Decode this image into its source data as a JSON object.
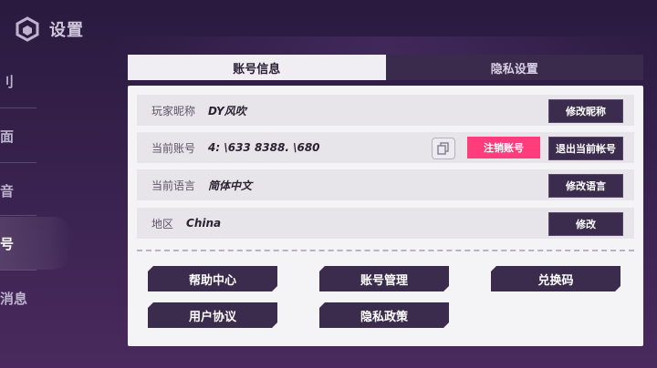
{
  "header": {
    "title": "设置",
    "icon": "cube-icon"
  },
  "sidebar": {
    "items": [
      {
        "label": "刂"
      },
      {
        "label": "面"
      },
      {
        "label": "音"
      },
      {
        "label": "号"
      },
      {
        "label": "消息"
      }
    ],
    "active_index": 3
  },
  "tabs": [
    {
      "label": "账号信息",
      "active": true
    },
    {
      "label": "隐私设置",
      "active": false
    }
  ],
  "rows": {
    "nickname": {
      "label": "玩家昵称",
      "value": "DY风吹",
      "button": "修改昵称"
    },
    "account": {
      "label": "当前账号",
      "value": "4:  \\633  8388. \\680",
      "copy_icon": "copy-icon",
      "deregister": "注销账号",
      "logout": "退出当前帐号"
    },
    "language": {
      "label": "当前语言",
      "value": "简体中文",
      "button": "修改语言"
    },
    "region": {
      "label": "地区",
      "value": "China",
      "button": "修改"
    }
  },
  "actions": {
    "help": "帮助中心",
    "account_manage": "账号管理",
    "redeem": "兑换码",
    "user_agreement": "用户协议",
    "privacy_policy": "隐私政策"
  },
  "colors": {
    "accent_pink": "#ff3d7d",
    "button_dark": "#3b2c4e",
    "panel_bg": "#f4f3f6"
  }
}
